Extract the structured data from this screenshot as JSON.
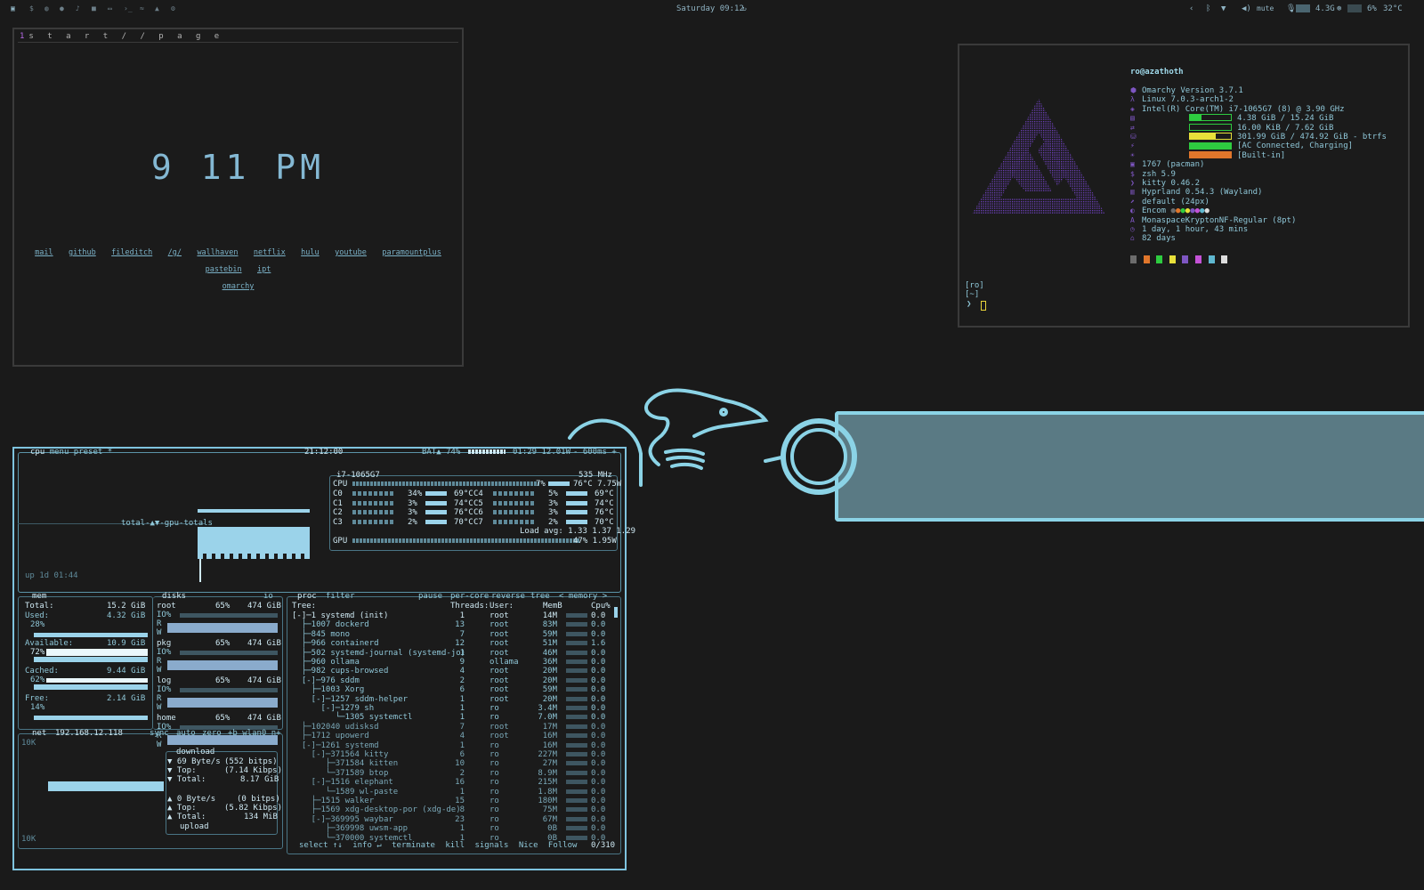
{
  "topbar": {
    "date": "Saturday 09:12",
    "refresh_icon": "refresh-icon",
    "mute_label": "mute",
    "mem_value": "4.3G",
    "disk_value": "6%",
    "temp_value": "32°C",
    "left_icons": [
      "app-icon",
      "term-icon",
      "web-icon",
      "chat-icon",
      "music-icon",
      "folder-icon",
      "window-icon",
      "code-icon",
      "cloud-icon",
      "gear-icon"
    ]
  },
  "startpage": {
    "workspace_num": "1",
    "title": "s t a r t / / p a g e",
    "clock": "9 11 PM",
    "links": [
      "mail",
      "github",
      "fileditch",
      "/g/",
      "wallhaven",
      "netflix",
      "hulu",
      "youtube",
      "paramountplus",
      "pastebin",
      "ipt",
      "omarchy"
    ]
  },
  "neofetch": {
    "user_host": "ro@azathoth",
    "lines": [
      "Omarchy Version 3.7.1",
      "Linux 7.0.3-arch1-2",
      "Intel(R) Core(TM) i7-1065G7 (8) @ 3.90 GHz",
      "4.38 GiB / 15.24 GiB",
      "16.00 KiB / 7.62 GiB",
      "301.99 GiB / 474.92 GiB - btrfs",
      "[AC Connected, Charging]",
      "[Built-in]",
      "1767 (pacman)",
      "zsh 5.9",
      "kitty 0.46.2",
      "Hyprland 0.54.3 (Wayland)",
      "default (24px)",
      "Encom",
      "MonaspaceKryptonNF-Regular (8pt)",
      "1 day, 1 hour, 43 mins",
      "82 days"
    ],
    "bars": [
      {
        "fill": 0.29,
        "color": "#2ecc40"
      },
      {
        "fill": 0.0,
        "color": "#2ecc40"
      },
      {
        "fill": 0.64,
        "color": "#e8e03a"
      },
      {
        "fill": 1.0,
        "color": "#2ecc40"
      },
      {
        "fill": 1.0,
        "color": "#e0762b"
      }
    ],
    "prompt_user": "[ro]",
    "prompt_dir": "[~]",
    "prompt_symbol": "❯",
    "palette": [
      "#6c6c6c",
      "#e0762b",
      "#2ecc40",
      "#e8e03a",
      "#7e56c2",
      "#c452d6",
      "#5fb8d0",
      "#dddddd"
    ]
  },
  "btop": {
    "header": {
      "tabs": [
        "cpu",
        "menu",
        "preset *"
      ],
      "clock": "21:12:00",
      "battery": "BAT▲ 74%",
      "bat_time": "01:29 12.01W",
      "interval": "- 600ms +",
      "total_label": "total-▲▼-gpu-totals",
      "uptime": "up 1d 01:44"
    },
    "cpu": {
      "model": "i7-1065G7",
      "freq": "535 MHz",
      "total_pct": "7%",
      "total_temp": "76°C 7.75W",
      "cores": [
        {
          "name": "C0",
          "pct": "34%",
          "temp": "69°C"
        },
        {
          "name": "C1",
          "pct": "3%",
          "temp": "74°C"
        },
        {
          "name": "C2",
          "pct": "3%",
          "temp": "76°C"
        },
        {
          "name": "C3",
          "pct": "2%",
          "temp": "70°C"
        },
        {
          "name": "C4",
          "pct": "5%",
          "temp": "69°C"
        },
        {
          "name": "C5",
          "pct": "3%",
          "temp": "74°C"
        },
        {
          "name": "C6",
          "pct": "3%",
          "temp": "76°C"
        },
        {
          "name": "C7",
          "pct": "2%",
          "temp": "70°C"
        }
      ],
      "load_avg": "Load avg: 1.33 1.37 1.29",
      "gpu_label": "GPU",
      "gpu_stats": "47% 1.95W"
    },
    "mem": {
      "title": "mem",
      "total_label": "Total:",
      "total": "15.2 GiB",
      "used_label": "Used:",
      "used": "4.32 GiB",
      "used_pct": "28%",
      "avail_label": "Available:",
      "avail": "10.9 GiB",
      "avail_pct": "72%",
      "cached_label": "Cached:",
      "cached": "9.44 GiB",
      "cached_pct": "62%",
      "free_label": "Free:",
      "free": "2.14 GiB",
      "free_pct": "14%"
    },
    "disks": {
      "title": "disks",
      "io": "io",
      "items": [
        {
          "name": "root",
          "pct": "65%",
          "size": "474 GiB"
        },
        {
          "name": "pkg",
          "pct": "65%",
          "size": "474 GiB"
        },
        {
          "name": "log",
          "pct": "65%",
          "size": "474 GiB"
        },
        {
          "name": "home",
          "pct": "65%",
          "size": "474 GiB"
        }
      ]
    },
    "net": {
      "title": "net",
      "ip": "192.168.12.118",
      "tabs": [
        "sync",
        "auto",
        "zero",
        "+b wlan0 n+"
      ],
      "scale_top": "10K",
      "scale_bottom": "10K",
      "download_label": "download",
      "dl_rate": "69 Byte/s",
      "dl_bits": "(552 bitps)",
      "dl_top_label": "Top:",
      "dl_top": "(7.14 Kibps)",
      "dl_total_label": "Total:",
      "dl_total": "8.17 GiB",
      "ul_rate": "0 Byte/s",
      "ul_bits": "(0 bitps)",
      "ul_top_label": "Top:",
      "ul_top": "(5.82 Kibps)",
      "ul_total_label": "Total:",
      "ul_total": "134 MiB",
      "upload_label": "upload"
    },
    "proc": {
      "tabs": [
        "proc",
        "filter",
        "pause",
        "per-core",
        "reverse",
        "tree",
        "< memory >"
      ],
      "columns": [
        "Tree:",
        "Threads:",
        "User:",
        "MemB",
        "Cpu%"
      ],
      "rows": [
        {
          "tree": "[-]─1 systemd (init)",
          "thr": "1",
          "user": "root",
          "mem": "14M",
          "cpu": "0.0"
        },
        {
          "tree": "  ├─1007 dockerd",
          "thr": "13",
          "user": "root",
          "mem": "83M",
          "cpu": "0.0"
        },
        {
          "tree": "  ├─845 mono",
          "thr": "7",
          "user": "root",
          "mem": "59M",
          "cpu": "0.0"
        },
        {
          "tree": "  ├─966 containerd",
          "thr": "12",
          "user": "root",
          "mem": "51M",
          "cpu": "1.6"
        },
        {
          "tree": "  ├─502 systemd-journal (systemd-jo)",
          "thr": "1",
          "user": "root",
          "mem": "46M",
          "cpu": "0.0"
        },
        {
          "tree": "  ├─960 ollama",
          "thr": "9",
          "user": "ollama",
          "mem": "36M",
          "cpu": "0.0"
        },
        {
          "tree": "  ├─982 cups-browsed",
          "thr": "4",
          "user": "root",
          "mem": "20M",
          "cpu": "0.0"
        },
        {
          "tree": "  [-]─976 sddm",
          "thr": "2",
          "user": "root",
          "mem": "20M",
          "cpu": "0.0"
        },
        {
          "tree": "    ├─1003 Xorg",
          "thr": "6",
          "user": "root",
          "mem": "59M",
          "cpu": "0.0"
        },
        {
          "tree": "    [-]─1257 sddm-helper",
          "thr": "1",
          "user": "root",
          "mem": "20M",
          "cpu": "0.0"
        },
        {
          "tree": "      [-]─1279 sh",
          "thr": "1",
          "user": "ro",
          "mem": "3.4M",
          "cpu": "0.0"
        },
        {
          "tree": "         └─1305 systemctl",
          "thr": "1",
          "user": "ro",
          "mem": "7.0M",
          "cpu": "0.0"
        },
        {
          "tree": "  ├─102040 udisksd",
          "thr": "7",
          "user": "root",
          "mem": "17M",
          "cpu": "0.0"
        },
        {
          "tree": "  ├─1712 upowerd",
          "thr": "4",
          "user": "root",
          "mem": "16M",
          "cpu": "0.0"
        },
        {
          "tree": "  [-]─1261 systemd",
          "thr": "1",
          "user": "ro",
          "mem": "16M",
          "cpu": "0.0"
        },
        {
          "tree": "    [-]─371564 kitty",
          "thr": "6",
          "user": "ro",
          "mem": "227M",
          "cpu": "0.0"
        },
        {
          "tree": "       ├─371584 kitten",
          "thr": "10",
          "user": "ro",
          "mem": "27M",
          "cpu": "0.0"
        },
        {
          "tree": "       └─371589 btop",
          "thr": "2",
          "user": "ro",
          "mem": "8.9M",
          "cpu": "0.0"
        },
        {
          "tree": "    [-]─1516 elephant",
          "thr": "16",
          "user": "ro",
          "mem": "215M",
          "cpu": "0.0"
        },
        {
          "tree": "       └─1589 wl-paste",
          "thr": "1",
          "user": "ro",
          "mem": "1.8M",
          "cpu": "0.0"
        },
        {
          "tree": "    ├─1515 walker",
          "thr": "15",
          "user": "ro",
          "mem": "180M",
          "cpu": "0.0"
        },
        {
          "tree": "    ├─1569 xdg-desktop-por (xdg-de)",
          "thr": "8",
          "user": "ro",
          "mem": "75M",
          "cpu": "0.0"
        },
        {
          "tree": "    [-]─369995 waybar",
          "thr": "23",
          "user": "ro",
          "mem": "67M",
          "cpu": "0.0"
        },
        {
          "tree": "       ├─369998 uwsm-app",
          "thr": "1",
          "user": "ro",
          "mem": "0B",
          "cpu": "0.0"
        },
        {
          "tree": "       └─370000 systemctl",
          "thr": "1",
          "user": "ro",
          "mem": "0B",
          "cpu": "0.0"
        }
      ],
      "footer": [
        "select ↑↓",
        "info ↵",
        "terminate",
        "kill",
        "signals",
        "Nice",
        "Follow"
      ],
      "count": "0/310"
    }
  }
}
